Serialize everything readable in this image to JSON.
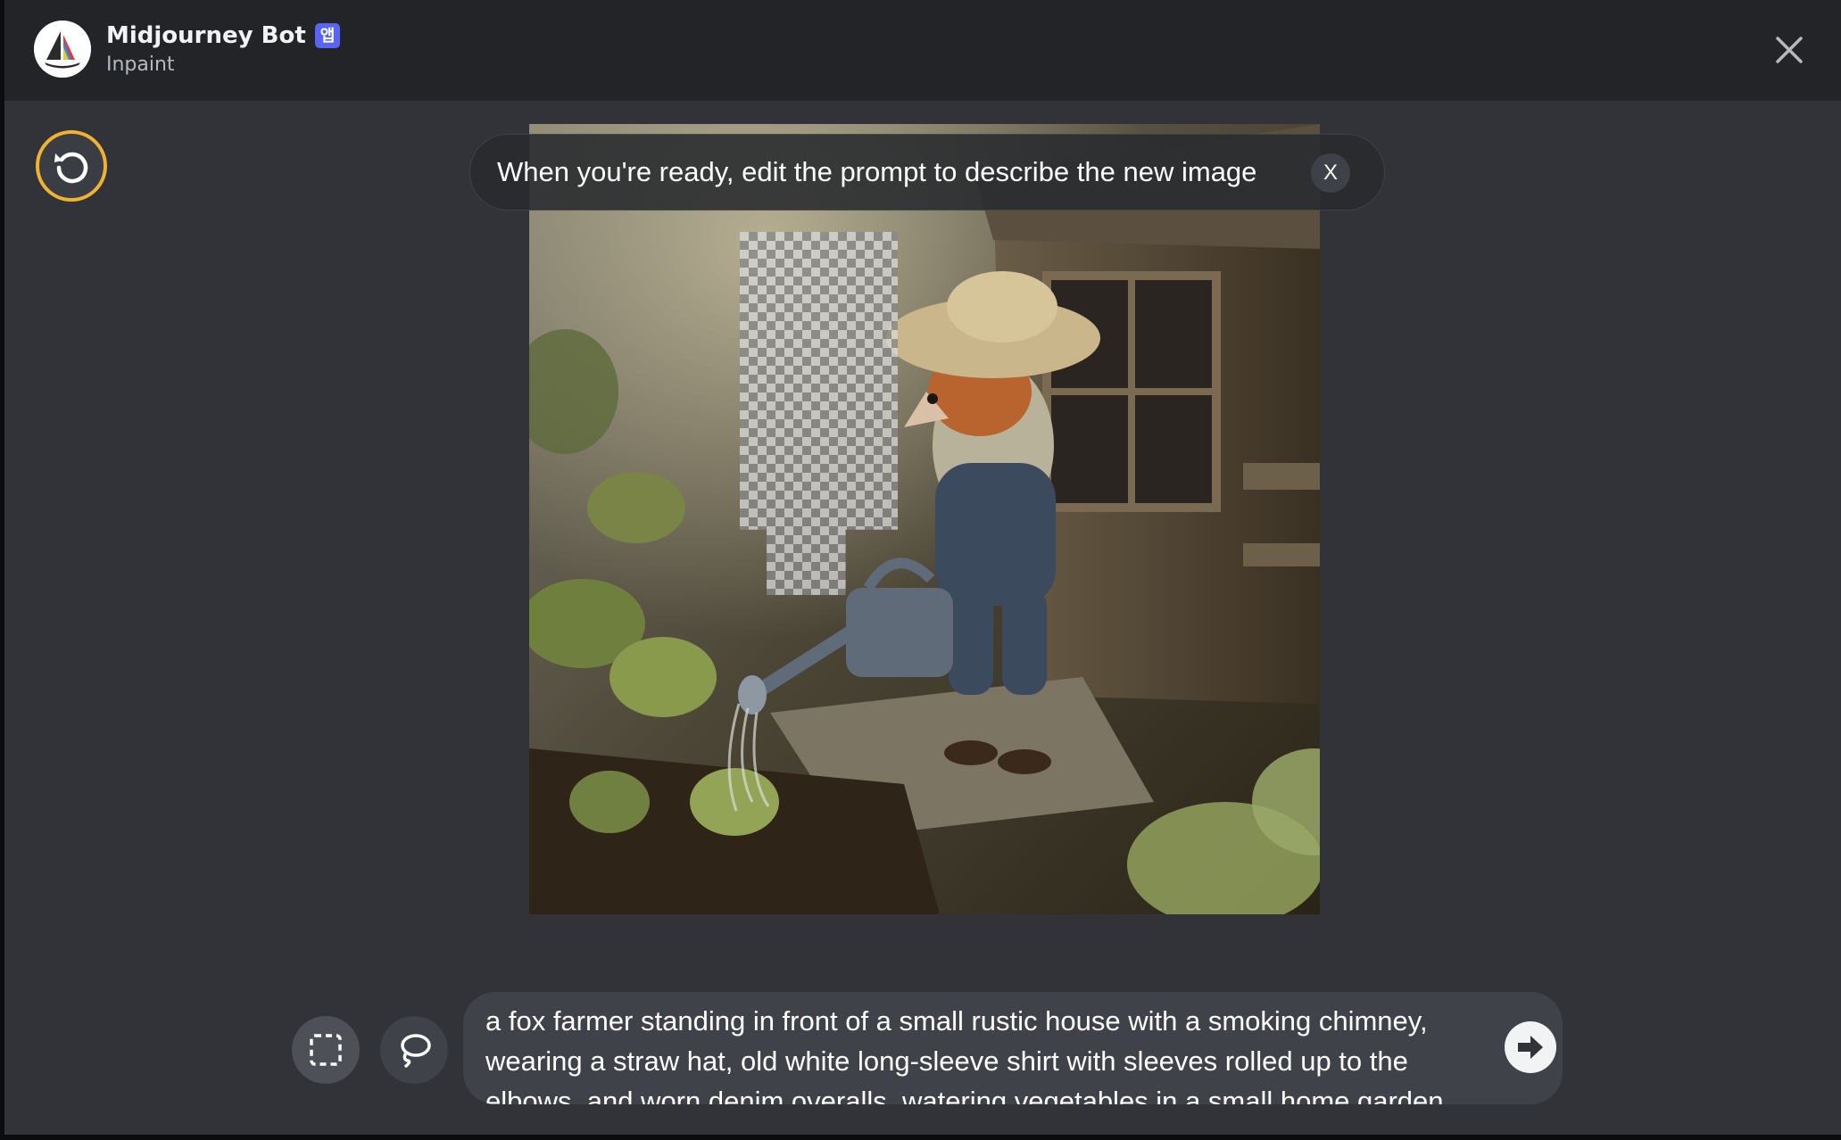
{
  "header": {
    "title": "Midjourney Bot",
    "app_badge": "앱",
    "subtitle": "Inpaint",
    "close_icon": "close-icon"
  },
  "canvas": {
    "reset_icon": "undo-icon",
    "image_alt": "fox farmer watering vegetables in front of a rustic house",
    "mask_icon": "transparency-mask"
  },
  "toast": {
    "message": "When you're ready, edit the prompt to describe the new image",
    "close_label": "X"
  },
  "tools": {
    "rect_icon": "rectangle-select-icon",
    "lasso_icon": "lasso-select-icon"
  },
  "prompt": {
    "value": "a fox farmer standing in front of a small rustic house with a smoking chimney, wearing a straw hat, old white long-sleeve shirt with sleeves rolled up to the elbows, and worn denim overalls, watering vegetables in a small home garden",
    "send_icon": "arrow-right-icon"
  },
  "colors": {
    "modal_bg": "#313338",
    "header_bg": "#232428",
    "badge": "#5865f2",
    "reset_ring": "#f0b232"
  }
}
